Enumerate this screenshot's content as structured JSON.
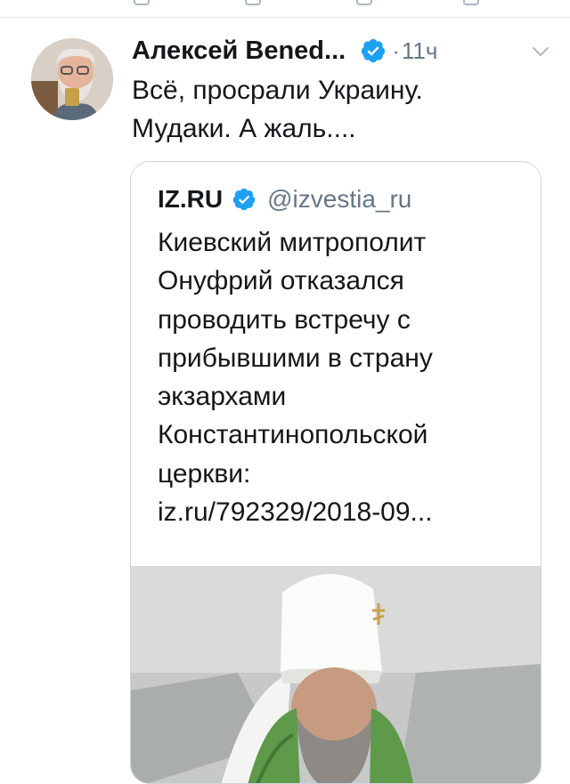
{
  "tweet": {
    "author_name": "Алексей Вened...",
    "time": "11ч",
    "dot": "·",
    "text_lines": [
      "Всё, просрали Украину.",
      "Мудаки. А жаль...."
    ]
  },
  "quote": {
    "name": "IZ.RU",
    "handle": "@izvestia_ru",
    "text_lines": [
      "Киевский митрополит",
      "Онуфрий отказался",
      "проводить встречу с",
      "прибывшими в страну",
      "экзархами",
      "Константинопольской",
      "церкви:",
      "iz.ru/792329/2018-09..."
    ]
  },
  "icons": {
    "verified": "verified-badge-icon",
    "caret": "chevron-down-icon"
  },
  "colors": {
    "verified": "#1da1f2",
    "secondary_text": "#657786",
    "border": "#ccd6dd"
  }
}
